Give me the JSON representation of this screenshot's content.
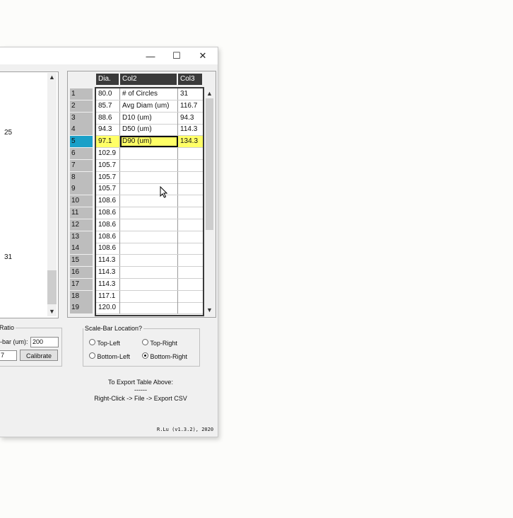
{
  "window": {
    "minimize_glyph": "—",
    "maximize_glyph": "☐",
    "close_glyph": "✕"
  },
  "left_panel": {
    "labels": [
      "25",
      "31"
    ]
  },
  "table": {
    "headers": [
      "Dia.",
      "Col2",
      "Col3"
    ],
    "rows": [
      {
        "n": "1",
        "dia": "80.0",
        "col2": "# of Circles",
        "col3": "31"
      },
      {
        "n": "2",
        "dia": "85.7",
        "col2": "Avg Diam (um)",
        "col3": "116.7"
      },
      {
        "n": "3",
        "dia": "88.6",
        "col2": "D10 (um)",
        "col3": "94.3"
      },
      {
        "n": "4",
        "dia": "94.3",
        "col2": "D50 (um)",
        "col3": "114.3"
      },
      {
        "n": "5",
        "dia": "97.1",
        "col2": "D90 (um)",
        "col3": "134.3"
      },
      {
        "n": "6",
        "dia": "102.9",
        "col2": "",
        "col3": ""
      },
      {
        "n": "7",
        "dia": "105.7",
        "col2": "",
        "col3": ""
      },
      {
        "n": "8",
        "dia": "105.7",
        "col2": "",
        "col3": ""
      },
      {
        "n": "9",
        "dia": "105.7",
        "col2": "",
        "col3": ""
      },
      {
        "n": "10",
        "dia": "108.6",
        "col2": "",
        "col3": ""
      },
      {
        "n": "11",
        "dia": "108.6",
        "col2": "",
        "col3": ""
      },
      {
        "n": "12",
        "dia": "108.6",
        "col2": "",
        "col3": ""
      },
      {
        "n": "13",
        "dia": "108.6",
        "col2": "",
        "col3": ""
      },
      {
        "n": "14",
        "dia": "108.6",
        "col2": "",
        "col3": ""
      },
      {
        "n": "15",
        "dia": "114.3",
        "col2": "",
        "col3": ""
      },
      {
        "n": "16",
        "dia": "114.3",
        "col2": "",
        "col3": ""
      },
      {
        "n": "17",
        "dia": "114.3",
        "col2": "",
        "col3": ""
      },
      {
        "n": "18",
        "dia": "117.1",
        "col2": "",
        "col3": ""
      },
      {
        "n": "19",
        "dia": "120.0",
        "col2": "",
        "col3": ""
      }
    ],
    "selected_row": 5,
    "selection_color": "#ffff66",
    "rowhdr_selected_color": "#1aa0c8"
  },
  "ratio_group": {
    "legend": "Ratio",
    "scale_bar_label": "-bar (um):",
    "scale_bar_value": "200",
    "second_value": "7",
    "calibrate_label": "Calibrate"
  },
  "scale_location": {
    "legend": "Scale-Bar Location?",
    "options": [
      "Top-Left",
      "Top-Right",
      "Bottom-Left",
      "Bottom-Right"
    ],
    "selected": "Bottom-Right"
  },
  "export_note": {
    "line1": "To Export Table Above:",
    "line2": "------",
    "line3": "Right-Click -> File -> Export CSV"
  },
  "footer": {
    "version": "R.Lu (v1.3.2), 2020"
  }
}
